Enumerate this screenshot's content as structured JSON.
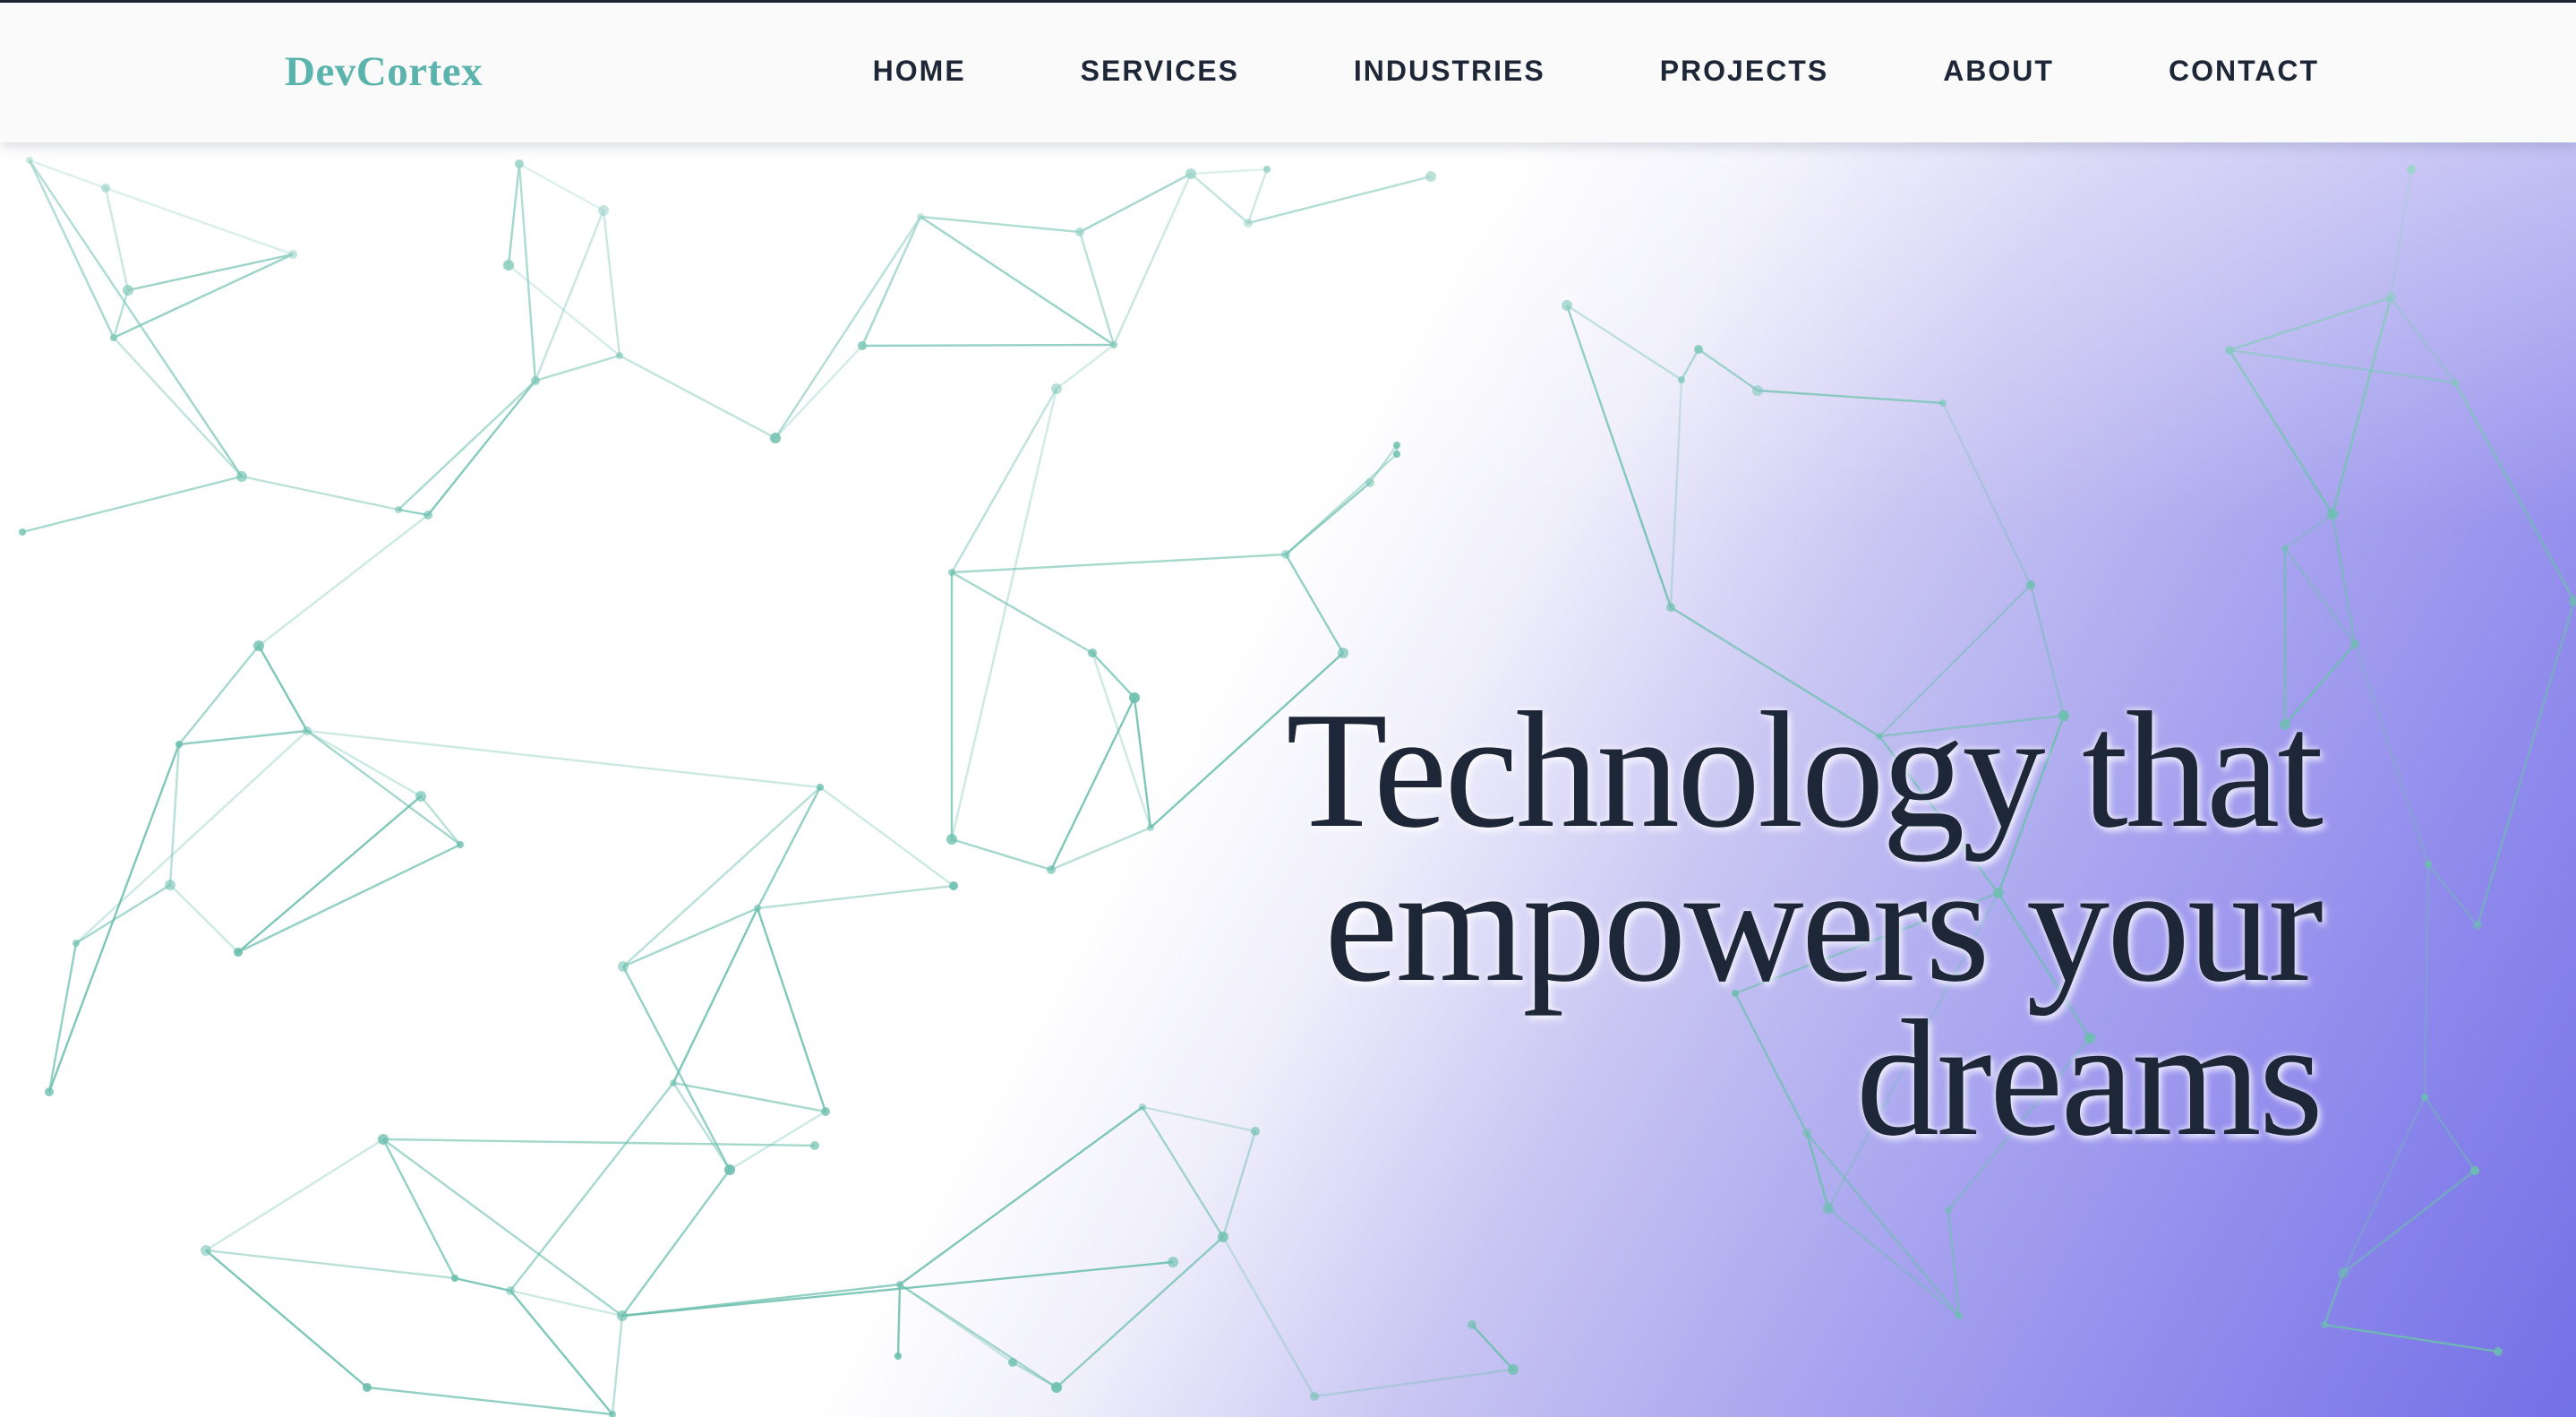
{
  "brand": {
    "logo_text": "DevCortex",
    "logo_color": "#5bb3ad"
  },
  "nav": {
    "items": [
      {
        "label": "HOME"
      },
      {
        "label": "SERVICES"
      },
      {
        "label": "INDUSTRIES"
      },
      {
        "label": "PROJECTS"
      },
      {
        "label": "ABOUT"
      },
      {
        "label": "CONTACT"
      }
    ]
  },
  "hero": {
    "headline_lines": [
      "Technology that",
      "empowers your",
      "dreams"
    ],
    "text_color": "#1e2737",
    "gradient_colors": [
      "#ffffff",
      "#c9c6f3",
      "#7470e6"
    ],
    "network_color": "#6cbfae"
  }
}
